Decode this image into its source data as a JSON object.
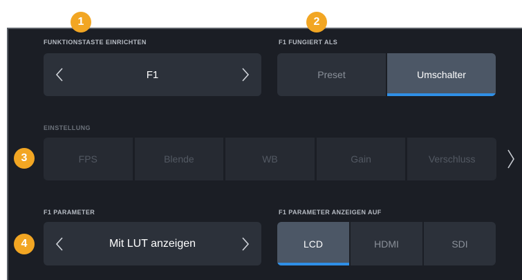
{
  "badges": [
    "1",
    "2",
    "3",
    "4"
  ],
  "function_key": {
    "label": "FUNKTIONSTASTE EINRICHTEN",
    "value": "F1"
  },
  "acts_as": {
    "label": "F1 FUNGIERT ALS",
    "options": [
      "Preset",
      "Umschalter"
    ],
    "selected": "Umschalter"
  },
  "setting": {
    "label": "EINSTELLUNG",
    "options": [
      "FPS",
      "Blende",
      "WB",
      "Gain",
      "Verschluss"
    ]
  },
  "parameter": {
    "label": "F1 PARAMETER",
    "value": "Mit LUT anzeigen"
  },
  "display_on": {
    "label": "F1 PARAMETER ANZEIGEN AUF",
    "options": [
      "LCD",
      "HDMI",
      "SDI"
    ],
    "selected": "LCD"
  },
  "colors": {
    "background": "#1b1e25",
    "control": "#2c313a",
    "active": "#4c5766",
    "accent": "#2f8fe6",
    "badge": "#f2a623"
  }
}
